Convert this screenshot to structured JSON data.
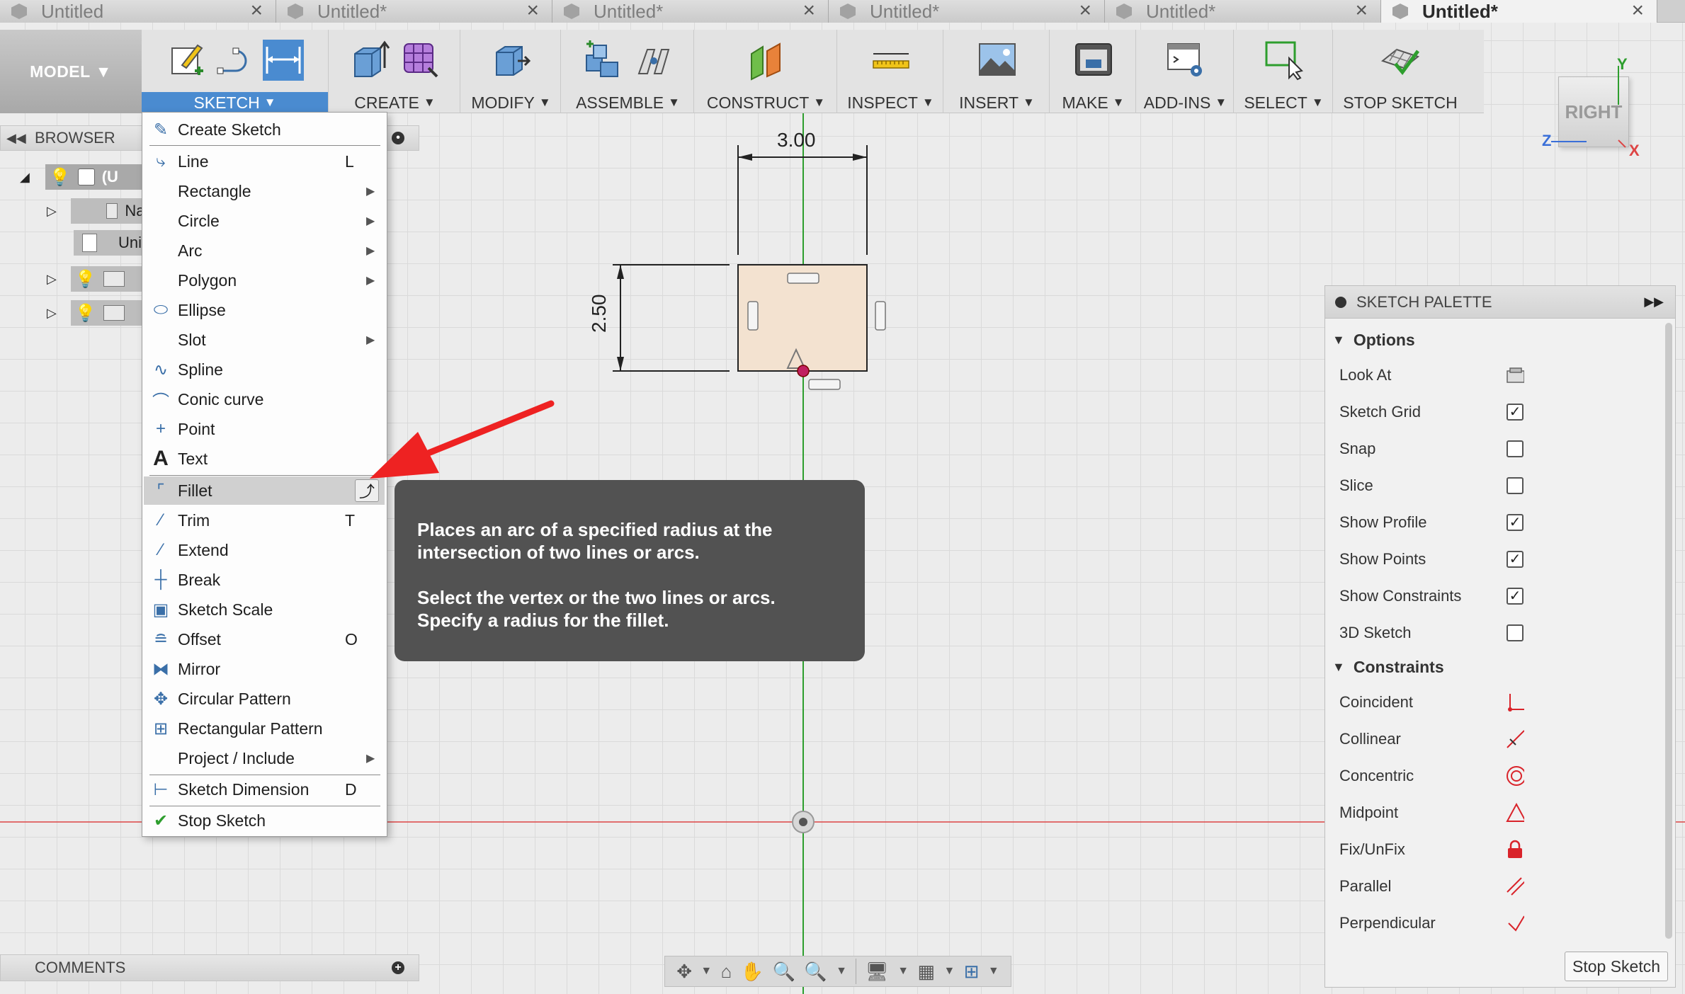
{
  "tabs": [
    {
      "label": "Untitled",
      "active": false
    },
    {
      "label": "Untitled*",
      "active": false
    },
    {
      "label": "Untitled*",
      "active": false
    },
    {
      "label": "Untitled*",
      "active": false
    },
    {
      "label": "Untitled*",
      "active": false
    },
    {
      "label": "Untitled*",
      "active": true
    }
  ],
  "toolbar": {
    "workspace": "MODEL",
    "groups": [
      {
        "label": "SKETCH",
        "active": true
      },
      {
        "label": "CREATE"
      },
      {
        "label": "MODIFY"
      },
      {
        "label": "ASSEMBLE"
      },
      {
        "label": "CONSTRUCT"
      },
      {
        "label": "INSPECT"
      },
      {
        "label": "INSERT"
      },
      {
        "label": "MAKE"
      },
      {
        "label": "ADD-INS"
      },
      {
        "label": "SELECT"
      },
      {
        "label": "STOP SKETCH"
      }
    ]
  },
  "viewcube": {
    "face": "RIGHT",
    "axis_y": "Y",
    "axis_z": "Z",
    "axis_x": "X"
  },
  "browser": {
    "title": "BROWSER",
    "rows": [
      "(U",
      "Nar",
      "Uni",
      "",
      ""
    ]
  },
  "sketch_menu": {
    "items": [
      {
        "label": "Create Sketch",
        "shortcut": "",
        "submenu": false,
        "icon": "create-sketch-icon"
      },
      {
        "label": "Line",
        "shortcut": "L",
        "submenu": false,
        "icon": "line-icon"
      },
      {
        "label": "Rectangle",
        "shortcut": "",
        "submenu": true,
        "icon": ""
      },
      {
        "label": "Circle",
        "shortcut": "",
        "submenu": true,
        "icon": ""
      },
      {
        "label": "Arc",
        "shortcut": "",
        "submenu": true,
        "icon": ""
      },
      {
        "label": "Polygon",
        "shortcut": "",
        "submenu": true,
        "icon": ""
      },
      {
        "label": "Ellipse",
        "shortcut": "",
        "submenu": false,
        "icon": "ellipse-icon"
      },
      {
        "label": "Slot",
        "shortcut": "",
        "submenu": true,
        "icon": ""
      },
      {
        "label": "Spline",
        "shortcut": "",
        "submenu": false,
        "icon": "spline-icon"
      },
      {
        "label": "Conic curve",
        "shortcut": "",
        "submenu": false,
        "icon": "conic-icon"
      },
      {
        "label": "Point",
        "shortcut": "",
        "submenu": false,
        "icon": "point-icon"
      },
      {
        "label": "Text",
        "shortcut": "",
        "submenu": false,
        "icon": "text-icon"
      },
      {
        "label": "Fillet",
        "shortcut": "",
        "submenu": false,
        "icon": "fillet-icon",
        "highlighted": true
      },
      {
        "label": "Trim",
        "shortcut": "T",
        "submenu": false,
        "icon": "trim-icon"
      },
      {
        "label": "Extend",
        "shortcut": "",
        "submenu": false,
        "icon": "extend-icon"
      },
      {
        "label": "Break",
        "shortcut": "",
        "submenu": false,
        "icon": "break-icon"
      },
      {
        "label": "Sketch Scale",
        "shortcut": "",
        "submenu": false,
        "icon": "scale-icon"
      },
      {
        "label": "Offset",
        "shortcut": "O",
        "submenu": false,
        "icon": "offset-icon"
      },
      {
        "label": "Mirror",
        "shortcut": "",
        "submenu": false,
        "icon": "mirror-icon"
      },
      {
        "label": "Circular Pattern",
        "shortcut": "",
        "submenu": false,
        "icon": "circular-pattern-icon"
      },
      {
        "label": "Rectangular Pattern",
        "shortcut": "",
        "submenu": false,
        "icon": "rectangular-pattern-icon"
      },
      {
        "label": "Project / Include",
        "shortcut": "",
        "submenu": true,
        "icon": ""
      },
      {
        "label": "Sketch Dimension",
        "shortcut": "D",
        "submenu": false,
        "icon": "dimension-icon"
      },
      {
        "label": "Stop Sketch",
        "shortcut": "",
        "submenu": false,
        "icon": "stop-sketch-icon"
      }
    ]
  },
  "tooltip": {
    "line1": "Places an arc of a specified radius at the intersection of two lines or arcs.",
    "line2": "Select the vertex or the two lines or arcs. Specify a radius for the fillet."
  },
  "sketch": {
    "dim_width": "3.00",
    "dim_height": "2.50"
  },
  "palette": {
    "title": "SKETCH PALETTE",
    "options_title": "Options",
    "options": [
      {
        "label": "Look At",
        "type": "button"
      },
      {
        "label": "Sketch Grid",
        "checked": true
      },
      {
        "label": "Snap",
        "checked": false
      },
      {
        "label": "Slice",
        "checked": false
      },
      {
        "label": "Show Profile",
        "checked": true
      },
      {
        "label": "Show Points",
        "checked": true
      },
      {
        "label": "Show Constraints",
        "checked": true
      },
      {
        "label": "3D Sketch",
        "checked": false
      }
    ],
    "constraints_title": "Constraints",
    "constraints": [
      {
        "label": "Coincident",
        "icon": "coincident-icon"
      },
      {
        "label": "Collinear",
        "icon": "collinear-icon"
      },
      {
        "label": "Concentric",
        "icon": "concentric-icon"
      },
      {
        "label": "Midpoint",
        "icon": "midpoint-icon"
      },
      {
        "label": "Fix/UnFix",
        "icon": "lock-icon"
      },
      {
        "label": "Parallel",
        "icon": "parallel-icon"
      },
      {
        "label": "Perpendicular",
        "icon": "perpendicular-icon"
      }
    ],
    "stop_button": "Stop Sketch"
  },
  "comments": {
    "title": "COMMENTS"
  },
  "colors": {
    "accent": "#4a8bd0",
    "constraint_red": "#d9232a",
    "axis_green": "#2e9e2e",
    "axis_red": "#d44"
  }
}
